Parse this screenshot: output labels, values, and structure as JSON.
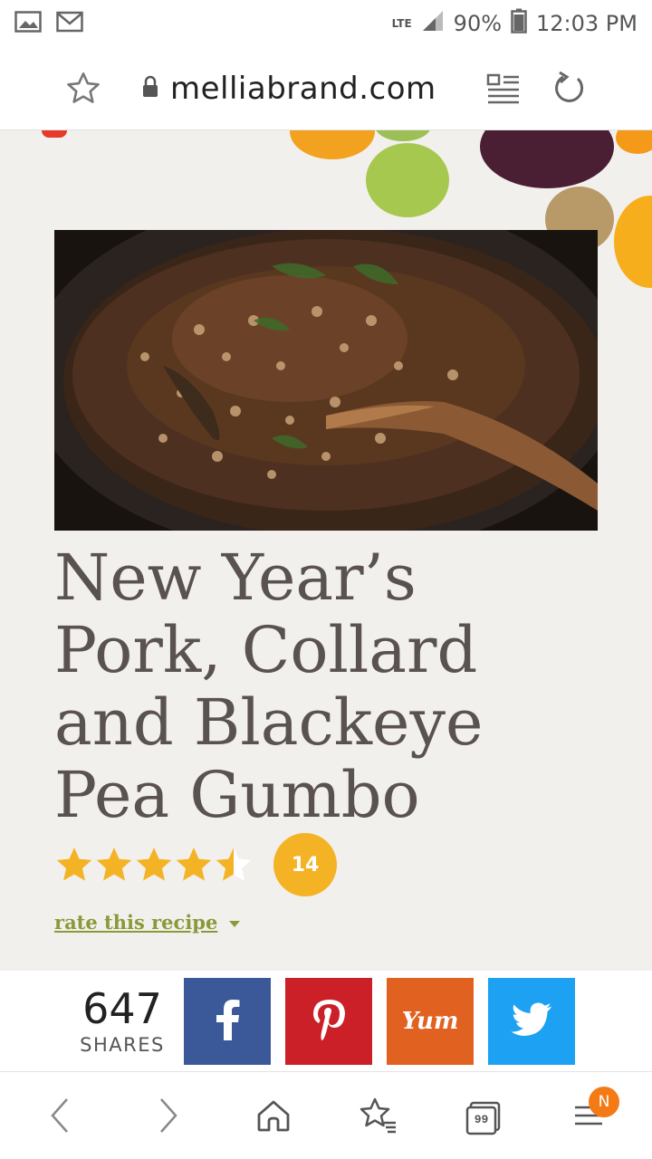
{
  "status_bar": {
    "network": "LTE",
    "battery": "90%",
    "time": "12:03 PM",
    "icons": [
      "gallery-icon",
      "gmail-icon",
      "signal-icon",
      "battery-icon"
    ]
  },
  "browser": {
    "url": "melliabrand.com",
    "icons": [
      "bookmark-star-icon",
      "lock-icon",
      "reader-mode-icon",
      "reload-icon"
    ]
  },
  "recipe": {
    "title": "New Year’s Pork, Collard and Blackeye Pea Gumbo",
    "rating": 4.5,
    "rating_max": 5,
    "rating_count": "14",
    "rate_link": "rate this recipe",
    "star_color": "#f4b325",
    "badge_color": "#f4b325"
  },
  "share": {
    "count": "647",
    "label": "SHARES",
    "buttons": [
      {
        "name": "facebook",
        "color": "#3b5998",
        "icon": "facebook-icon"
      },
      {
        "name": "pinterest",
        "color": "#cb2027",
        "icon": "pinterest-icon"
      },
      {
        "name": "yummly",
        "color": "#e16120",
        "icon": "yummly-icon",
        "label": "Yum"
      },
      {
        "name": "twitter",
        "color": "#1da1f2",
        "icon": "twitter-icon"
      }
    ]
  },
  "bottom_nav": {
    "items": [
      "back-icon",
      "forward-icon",
      "home-icon",
      "bookmarks-icon",
      "tabs-icon",
      "menu-icon"
    ],
    "tabs_count": "99",
    "notification": "N"
  }
}
